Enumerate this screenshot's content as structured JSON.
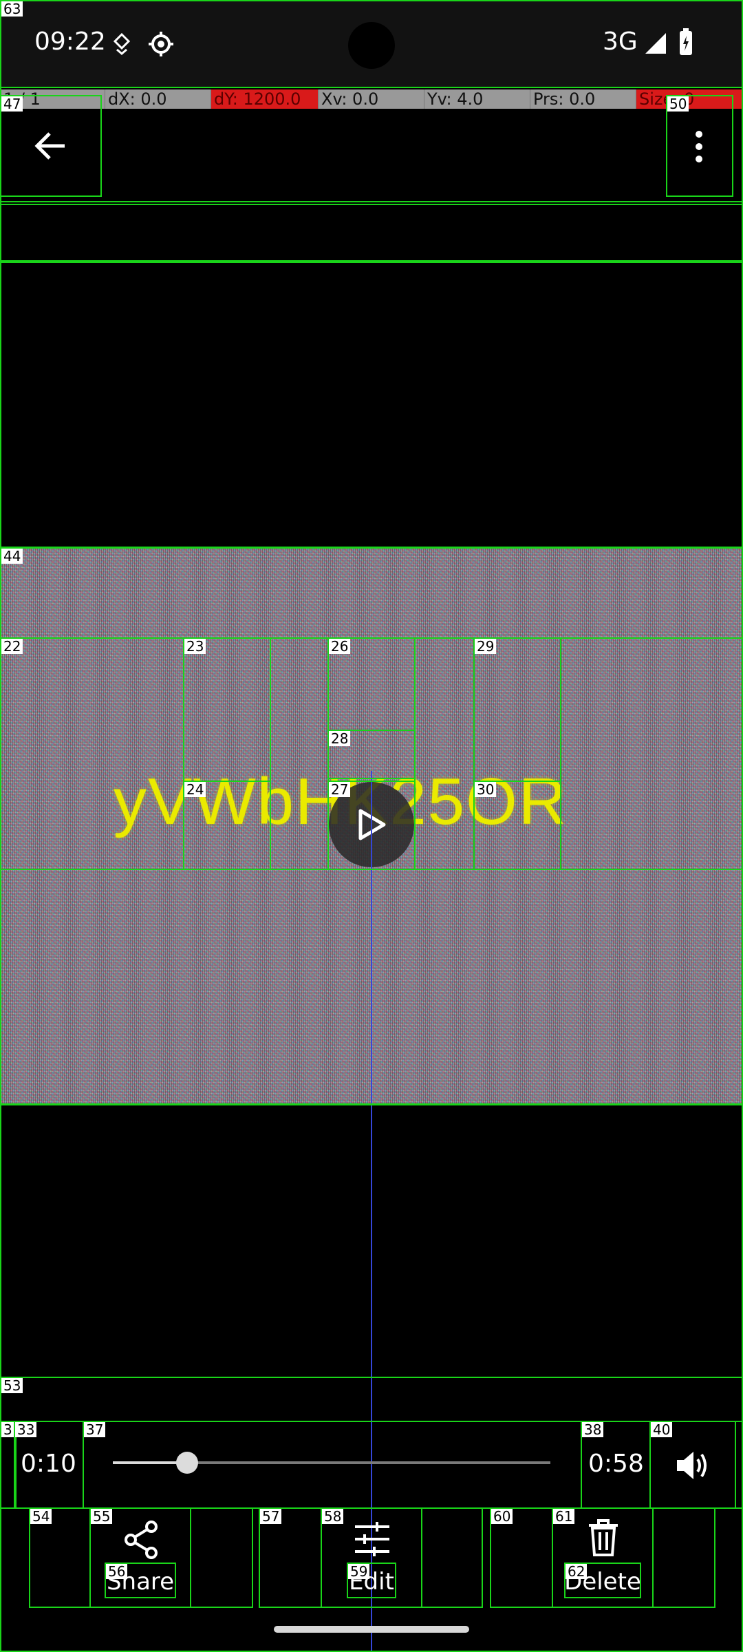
{
  "status_bar": {
    "time": "09:22",
    "network": "3G"
  },
  "debug_overlay": {
    "pointers": "1 / 1",
    "dx": "dX: 0.0",
    "dy": "dY: 1200.0",
    "xv": "Xv: 0.0",
    "yv": "Yv: 4.0",
    "prs": "Prs: 0.0",
    "size": "Size: 0"
  },
  "viewer": {
    "watermark_text": "yVWbHK25OR"
  },
  "player": {
    "current_time": "0:10",
    "duration": "0:58",
    "progress": 0.17
  },
  "actions": [
    {
      "label": "Share",
      "icon": "share-icon"
    },
    {
      "label": "Edit",
      "icon": "tune-icon"
    },
    {
      "label": "Delete",
      "icon": "trash-icon"
    }
  ],
  "overlay_tags": {
    "t63": "63",
    "t47": "47",
    "t50": "50",
    "t44": "44",
    "t22": "22",
    "t23": "23",
    "t24": "24",
    "t26": "26",
    "t27": "27",
    "t28": "28",
    "t29": "29",
    "t30": "30",
    "t53": "53",
    "t3": "3",
    "t33": "33",
    "t37": "37",
    "t38": "38",
    "t40": "40",
    "t54": "54",
    "t55": "55",
    "t56": "56",
    "t57": "57",
    "t58": "58",
    "t59": "59",
    "t60": "60",
    "t61": "61",
    "t62": "62"
  },
  "colors": {
    "overlay_box": "#19d419",
    "debug_highlight": "#d91a1a",
    "watermark": "#eaea00"
  }
}
